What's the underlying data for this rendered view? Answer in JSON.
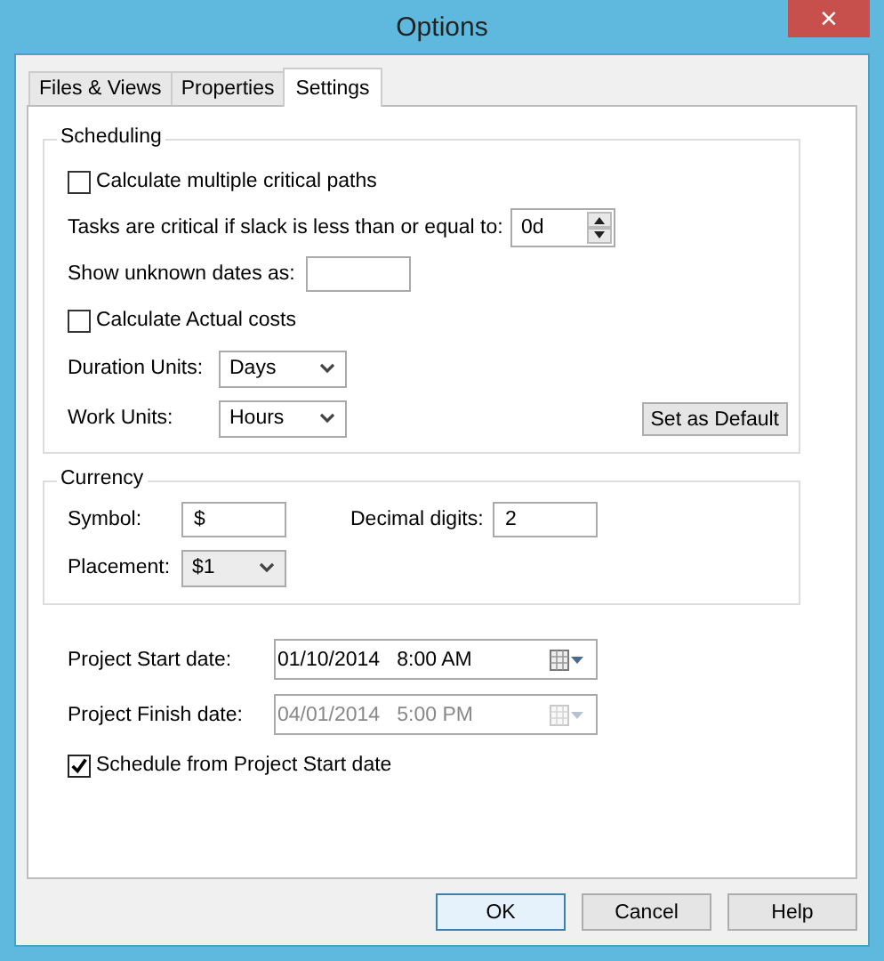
{
  "window": {
    "title": "Options",
    "close": "×"
  },
  "tabs": [
    {
      "label": "Files & Views",
      "selected": false
    },
    {
      "label": "Properties",
      "selected": false
    },
    {
      "label": "Settings",
      "selected": true
    }
  ],
  "scheduling": {
    "title": "Scheduling",
    "rows": [
      {
        "kind": "checkbox",
        "label": "Calculate multiple critical paths",
        "checked": false
      },
      {
        "kind": "spinner",
        "label": "Tasks are critical if slack is less than or equal to:",
        "value": "0d"
      },
      {
        "kind": "text",
        "label": "Show unknown dates as:"
      },
      {
        "kind": "checkbox",
        "label": "Calculate Actual costs",
        "checked": false
      },
      {
        "kind": "select",
        "label": "Duration Units:",
        "value": "Days"
      },
      {
        "kind": "select",
        "label": "Work Units:",
        "value": "Hours"
      }
    ],
    "default_button": "Set as Default"
  },
  "currency": {
    "title": "Currency",
    "symbol": {
      "label": "Symbol:",
      "value": "$"
    },
    "decimal_digits": {
      "label": "Decimal digits:",
      "value": "2"
    },
    "placement": {
      "label": "Placement:",
      "value": "$1"
    }
  },
  "dates": [
    {
      "label": "Project Start date:",
      "value": "01/10/2014   8:00 AM",
      "disabled": false
    },
    {
      "label": "Project Finish date:",
      "value": "04/01/2014   5:00 PM",
      "disabled": true
    }
  ],
  "schedule_from_start": {
    "label": "Schedule from Project Start date",
    "checked": true
  },
  "buttons": [
    {
      "label": "OK",
      "default": true
    },
    {
      "label": "Cancel",
      "default": false
    },
    {
      "label": "Help",
      "default": false
    }
  ]
}
